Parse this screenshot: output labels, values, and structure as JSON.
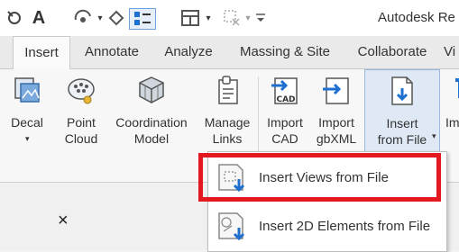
{
  "app": {
    "title": "Autodesk Re"
  },
  "qat": {
    "font_letter": "A",
    "dropdown_glyph": "▾",
    "overflow_glyph": "▾"
  },
  "tabs": [
    {
      "label": "Insert",
      "active": true
    },
    {
      "label": "Annotate",
      "active": false
    },
    {
      "label": "Analyze",
      "active": false
    },
    {
      "label": "Massing & Site",
      "active": false
    },
    {
      "label": "Collaborate",
      "active": false
    },
    {
      "label": "Vi",
      "active": false
    }
  ],
  "ribbon": {
    "tools": [
      {
        "label": "Decal",
        "has_dropdown": true,
        "icon": "decal-icon"
      },
      {
        "label": "Point\nCloud",
        "icon": "point-cloud-icon"
      },
      {
        "label": "Coordination\nModel",
        "icon": "coordination-model-icon"
      },
      {
        "label": "Manage\nLinks",
        "icon": "manage-links-icon"
      },
      {
        "label": "Import\nCAD",
        "icon": "import-cad-icon",
        "badge": "CAD"
      },
      {
        "label": "Import\ngbXML",
        "icon": "import-gbxml-icon"
      },
      {
        "label": "Insert\nfrom File",
        "icon": "insert-from-file-icon",
        "selected": true,
        "has_dropdown": true
      },
      {
        "label": "Im",
        "icon": "image-icon"
      }
    ]
  },
  "menu": {
    "items": [
      {
        "label": "Insert Views from File",
        "icon": "insert-views-icon",
        "highlighted": true
      },
      {
        "label": "Insert 2D Elements from File",
        "icon": "insert-2d-elements-icon"
      }
    ]
  },
  "panel": {
    "close_glyph": "×"
  },
  "colors": {
    "highlight": "#e4191f",
    "accent_blue": "#1f6fd1",
    "selected_bg": "#dfe9f6"
  }
}
